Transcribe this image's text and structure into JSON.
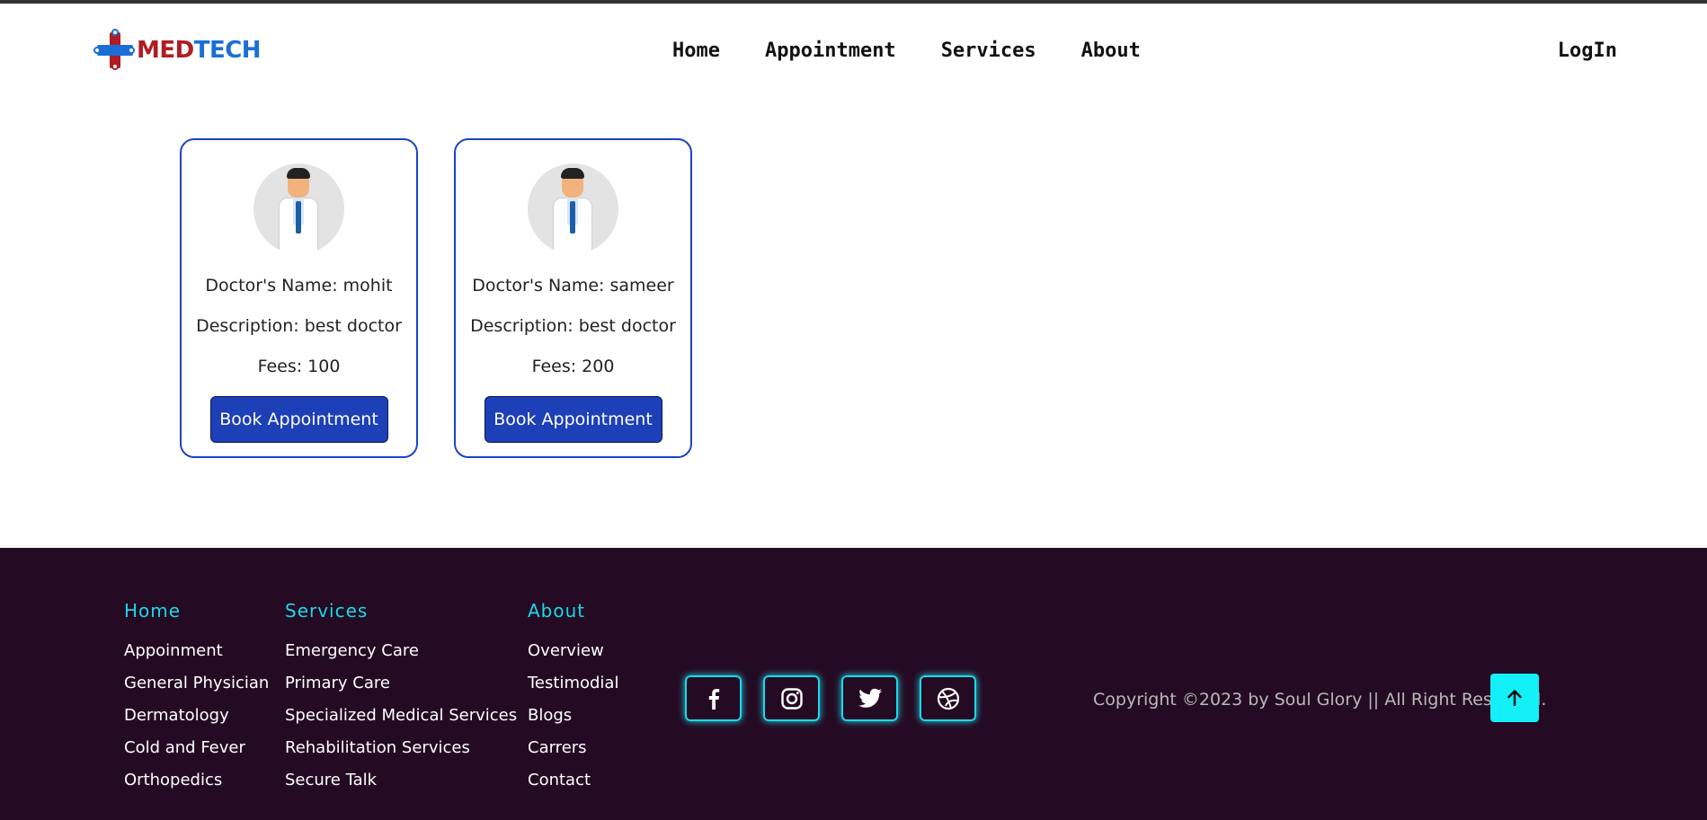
{
  "header": {
    "logo": {
      "part1": "MED",
      "part2": "TECH"
    },
    "nav": [
      {
        "label": "Home"
      },
      {
        "label": "Appointment"
      },
      {
        "label": "Services"
      },
      {
        "label": "About"
      }
    ],
    "login_label": "LogIn"
  },
  "doctors": [
    {
      "name_text": "Doctor's Name: mohit",
      "description_text": "Description: best doctor",
      "fees_text": "Fees: 100",
      "button_label": "Book Appointment"
    },
    {
      "name_text": "Doctor's Name: sameer",
      "description_text": "Description: best doctor",
      "fees_text": "Fees: 200",
      "button_label": "Book Appointment"
    }
  ],
  "footer": {
    "columns": [
      {
        "heading": "Home",
        "items": [
          "Appoinment",
          "General Physician",
          "Dermatology",
          "Cold and Fever",
          "Orthopedics"
        ]
      },
      {
        "heading": "Services",
        "items": [
          "Emergency Care",
          "Primary Care",
          "Specialized Medical Services",
          "Rehabilitation Services",
          "Secure Talk"
        ]
      },
      {
        "heading": "About",
        "items": [
          "Overview",
          "Testimodial",
          "Blogs",
          "Carrers",
          "Contact"
        ]
      }
    ],
    "socials": [
      "facebook-icon",
      "instagram-icon",
      "twitter-icon",
      "dribbble-icon"
    ],
    "copyright": "Copyright ©2023 by Soul Glory || All Right Reserved.",
    "to_top_icon": "arrow-up-icon"
  },
  "colors": {
    "brand_red": "#b01c23",
    "brand_blue": "#1a6fd6",
    "button_blue": "#1d3fb8",
    "footer_bg": "#240b23",
    "accent_cyan": "#1cd8e8"
  }
}
